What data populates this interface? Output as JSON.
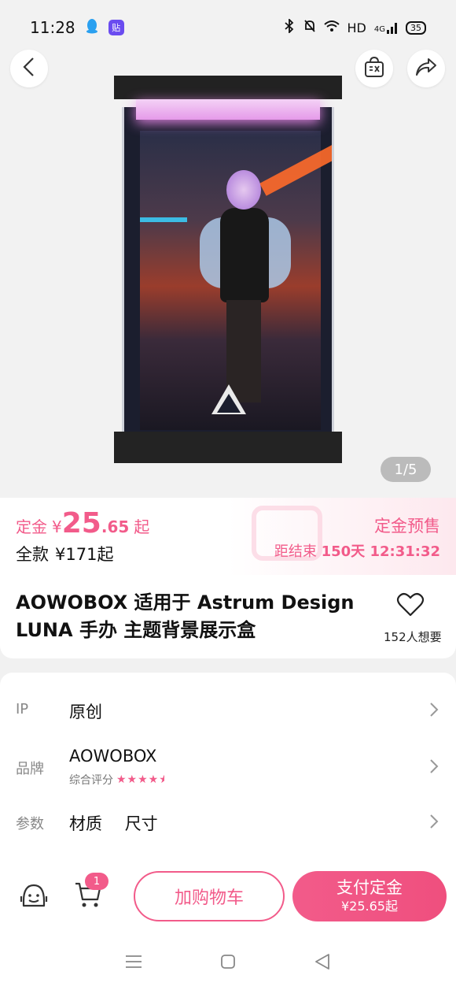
{
  "status_bar": {
    "time": "11:28",
    "network": "HD",
    "signal_label": "4G",
    "battery": "35"
  },
  "gallery": {
    "pager": "1/5"
  },
  "price": {
    "deposit_label": "定金",
    "currency": "¥",
    "deposit_int": "25",
    "deposit_dec": ".65",
    "from_suffix": "起",
    "full_label": "全款",
    "full_price": "¥171起",
    "presale_label": "定金预售",
    "countdown_prefix": "距结束",
    "countdown_value": "150天 12:31:32"
  },
  "product": {
    "title": "AOWOBOX 适用于 Astrum Design LUNA 手办 主题背景展示盒",
    "wish_count": "152人想要"
  },
  "params": {
    "ip_key": "IP",
    "ip_value": "原创",
    "brand_key": "品牌",
    "brand_value": "AOWOBOX",
    "rating_label": "综合评分",
    "rating_value": 4.5,
    "spec_key": "参数",
    "spec_values": [
      "材质",
      "尺寸"
    ]
  },
  "bottom_bar": {
    "cart_count": "1",
    "add_cart_label": "加购物车",
    "pay_label": "支付定金",
    "pay_price": "¥25.65起"
  },
  "colors": {
    "accent": "#f25b8a",
    "background": "#f1f1f1"
  }
}
